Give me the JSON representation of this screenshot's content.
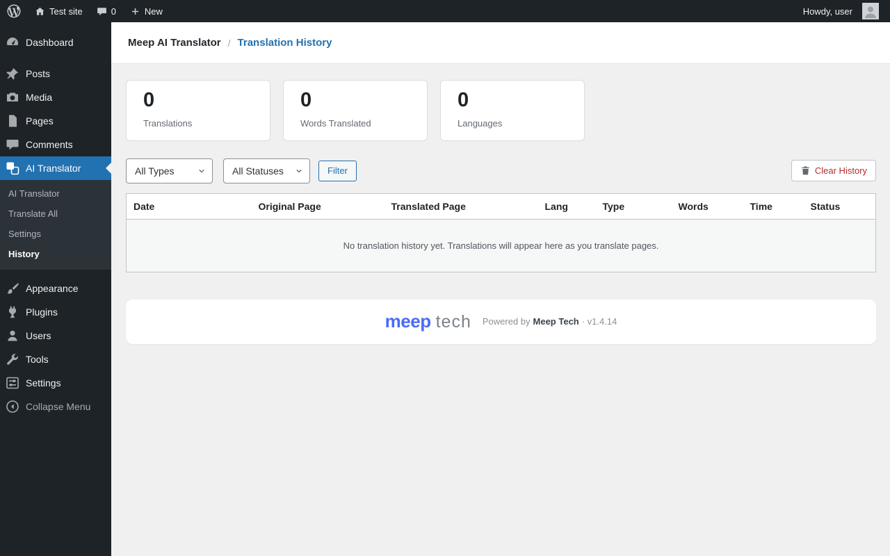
{
  "admin_bar": {
    "site_name": "Test site",
    "comments_count": "0",
    "new_label": "New",
    "howdy": "Howdy, user"
  },
  "sidebar": {
    "items": [
      {
        "label": "Dashboard"
      },
      {
        "label": "Posts"
      },
      {
        "label": "Media"
      },
      {
        "label": "Pages"
      },
      {
        "label": "Comments"
      },
      {
        "label": "AI Translator"
      },
      {
        "label": "Appearance"
      },
      {
        "label": "Plugins"
      },
      {
        "label": "Users"
      },
      {
        "label": "Tools"
      },
      {
        "label": "Settings"
      },
      {
        "label": "Collapse Menu"
      }
    ],
    "ai_submenu": [
      {
        "label": "AI Translator"
      },
      {
        "label": "Translate All"
      },
      {
        "label": "Settings"
      },
      {
        "label": "History"
      }
    ]
  },
  "breadcrumb": {
    "root": "Meep AI Translator",
    "separator": "/",
    "current": "Translation History"
  },
  "stats": [
    {
      "value": "0",
      "label": "Translations"
    },
    {
      "value": "0",
      "label": "Words Translated"
    },
    {
      "value": "0",
      "label": "Languages"
    }
  ],
  "filters": {
    "type_selected": "All Types",
    "status_selected": "All Statuses",
    "filter_label": "Filter",
    "clear_label": "Clear History"
  },
  "table": {
    "headers": [
      "Date",
      "Original Page",
      "Translated Page",
      "Lang",
      "Type",
      "Words",
      "Time",
      "Status"
    ],
    "empty_message": "No translation history yet. Translations will appear here as you translate pages."
  },
  "footer": {
    "logo_primary": "meep",
    "logo_secondary": "tech",
    "powered_prefix": "Powered by",
    "brand": "Meep Tech",
    "version": "· v1.4.14"
  },
  "colors": {
    "accent_blue": "#2271b1",
    "brand_blue": "#4a6cf7",
    "danger_red": "#b32d2e",
    "admin_dark": "#1d2327",
    "content_bg": "#f0f0f1"
  }
}
